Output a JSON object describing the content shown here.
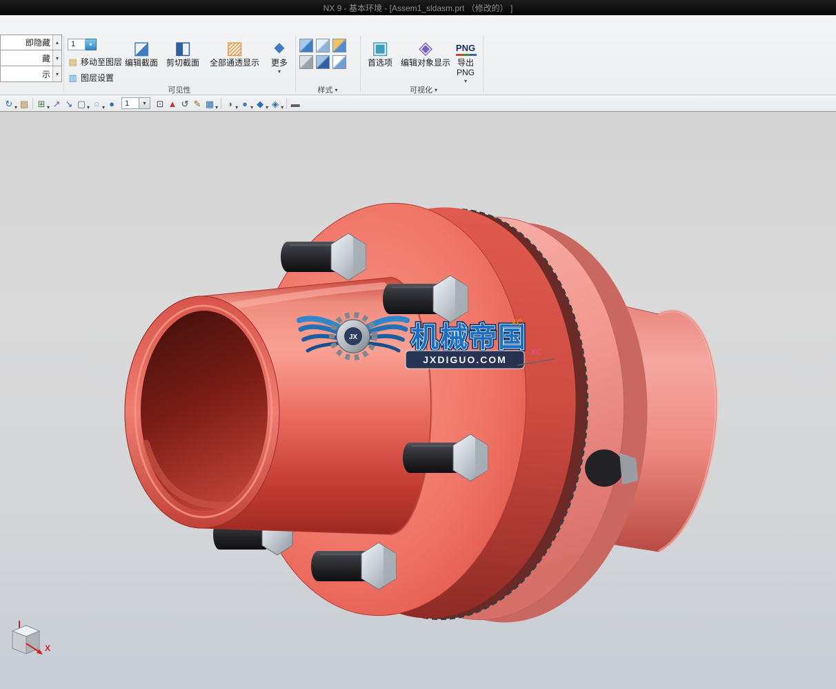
{
  "window": {
    "title": "NX 9 - 基本环境 - [Assem1_sldasm.prt （修改的） ]"
  },
  "glyphs": {
    "caret": "▾",
    "layers": "▤",
    "layer_settings": "▥",
    "edit_section": "◪",
    "clip_section": "◧",
    "translucent": "▨",
    "more": "◆",
    "preferences": "▣",
    "edit_object_display": "◈"
  },
  "ribbon": {
    "gallery": {
      "rows": [
        {
          "label": "即隐藏",
          "arrow": "▴"
        },
        {
          "label": "藏",
          "arrow": "▾"
        },
        {
          "label": "示",
          "arrow": "▾"
        }
      ]
    },
    "visibility": {
      "group_label": "可见性",
      "layer_combo": "1",
      "move_to_layer": "移动至图层",
      "layer_settings": "图层设置",
      "edit_section": "编辑截面",
      "clip_section": "剪切截面",
      "show_translucent": "全部通透显示",
      "more": "更多"
    },
    "style": {
      "group_label": "样式",
      "cubes": [
        {
          "c1": "#a8cbec",
          "c2": "#3f7dc0"
        },
        {
          "c1": "#e8f0f8",
          "c2": "#90b4d8"
        },
        {
          "c1": "#f2c25e",
          "c2": "#4f8fd0"
        },
        {
          "c1": "#dfe3e7",
          "c2": "#9aa2aa"
        },
        {
          "c1": "#9fc4e8",
          "c2": "#2f5f9f"
        },
        {
          "c1": "#ffffff",
          "c2": "#6f9fd0"
        }
      ]
    },
    "visualization": {
      "group_label": "可视化",
      "preferences": "首选项",
      "edit_object_display": "编辑对象显示",
      "export_png": "导出PNG",
      "png_badge": "PNG"
    }
  },
  "toolbar2": {
    "layer_combo": "1",
    "caret_glyph": "▾",
    "left_items": [
      {
        "name": "fit-view-icon",
        "glyph": "↻",
        "color": "#2e6db4",
        "caret": true
      },
      {
        "name": "refresh-icon",
        "glyph": "▧",
        "color": "#b07a30",
        "caret": false
      },
      {
        "sep": true
      },
      {
        "name": "expand-collapse-icon",
        "glyph": "⊞",
        "color": "#3f7d3f",
        "caret": true
      },
      {
        "name": "orient-view-icon",
        "glyph": "↗",
        "color": "#7a4fc0",
        "caret": false
      },
      {
        "name": "pan-icon",
        "glyph": "↘",
        "color": "#2e6db4",
        "caret": false
      },
      {
        "name": "marquee-select-icon",
        "glyph": "▢",
        "color": "#5a5f66",
        "caret": true
      },
      {
        "name": "circle-select-icon",
        "glyph": "◌",
        "color": "#5a5f66",
        "caret": true
      },
      {
        "name": "snap-sphere-icon",
        "glyph": "●",
        "color": "#2e6db4",
        "caret": false
      }
    ],
    "right_items": [
      {
        "name": "zoom-box-icon",
        "glyph": "⊡",
        "color": "#44484e",
        "caret": false
      },
      {
        "name": "csys-icon",
        "glyph": "▲",
        "color": "#c03a2e",
        "caret": false
      },
      {
        "name": "rotate-view-icon",
        "glyph": "↺",
        "color": "#44484e",
        "caret": false
      },
      {
        "name": "brush-icon",
        "glyph": "✎",
        "color": "#8a6a20",
        "caret": false
      },
      {
        "name": "grid-display-icon",
        "glyph": "▦",
        "color": "#2e6db4",
        "caret": true
      },
      {
        "sep": true
      },
      {
        "name": "render-style-icon",
        "glyph": "◑",
        "color": "#6a7078",
        "caret": true
      },
      {
        "name": "shaded-view-icon",
        "glyph": "●",
        "color": "#3f7dc0",
        "caret": true
      },
      {
        "name": "diamond-tool-icon",
        "glyph": "◆",
        "color": "#2e6db4",
        "caret": true
      },
      {
        "name": "facet-settings-icon",
        "glyph": "◈",
        "color": "#2e6db4",
        "caret": true
      },
      {
        "sep": true
      },
      {
        "name": "ruler-icon",
        "glyph": "▬",
        "color": "#5a5f66",
        "caret": false
      }
    ]
  },
  "viewport": {
    "watermark": {
      "gear_text": "JX",
      "title": "机械帝国",
      "subtitle": "JXDIGUO.COM"
    },
    "axis_label_top": "XC",
    "axis_label_mid": "XC",
    "triad_x": "X"
  },
  "colors": {
    "flange_red": "#ee6b60",
    "flange_pink": "#f29b94",
    "hub_pink": "#ef8d85",
    "bolt_black": "#26262a",
    "nut_gray": "#c3cad1",
    "watermark_blue": "#1b6ec2",
    "banner_navy": "#1d3050",
    "axis_orange": "#e8821e",
    "axis_pink": "#e94f86",
    "triad_red": "#cc2222"
  }
}
